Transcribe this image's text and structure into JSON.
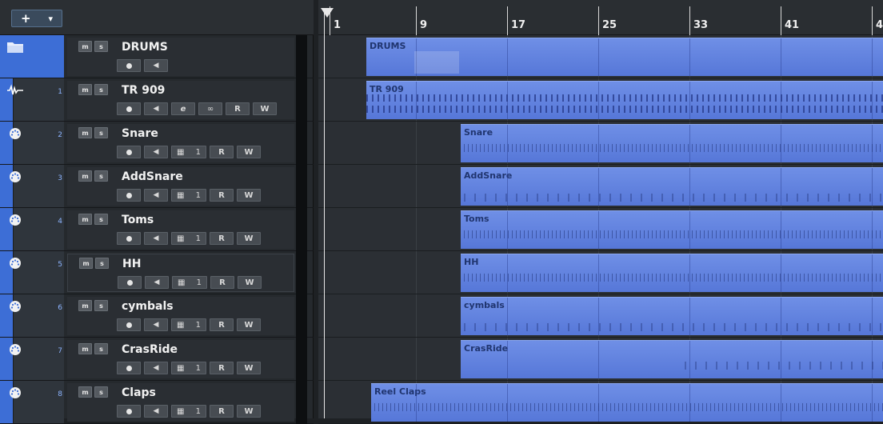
{
  "toolbar": {
    "add_label": "+",
    "dropdown": "▾"
  },
  "buttons": {
    "mute": "m",
    "solo": "s",
    "read": "R",
    "write": "W"
  },
  "tracks": [
    {
      "num": "",
      "name": "DRUMS",
      "type": "folder"
    },
    {
      "num": "1",
      "name": "TR 909",
      "type": "audio"
    },
    {
      "num": "2",
      "name": "Snare",
      "type": "midi",
      "channel": "1"
    },
    {
      "num": "3",
      "name": "AddSnare",
      "type": "midi",
      "channel": "1"
    },
    {
      "num": "4",
      "name": "Toms",
      "type": "midi",
      "channel": "1"
    },
    {
      "num": "5",
      "name": "HH",
      "type": "midi",
      "channel": "1"
    },
    {
      "num": "6",
      "name": "cymbals",
      "type": "midi",
      "channel": "1"
    },
    {
      "num": "7",
      "name": "CrasRide",
      "type": "midi",
      "channel": "1"
    },
    {
      "num": "8",
      "name": "Claps",
      "type": "midi",
      "channel": "1"
    }
  ],
  "ruler": {
    "bars": [
      "1",
      "9",
      "17",
      "25",
      "33",
      "41",
      "4"
    ]
  },
  "events": [
    {
      "name": "DRUMS"
    },
    {
      "name": "TR 909"
    },
    {
      "name": "Snare"
    },
    {
      "name": "AddSnare"
    },
    {
      "name": "Toms"
    },
    {
      "name": "HH"
    },
    {
      "name": "cymbals"
    },
    {
      "name": "CrasRide"
    },
    {
      "name": "Reel Claps"
    }
  ],
  "colors": {
    "accent": "#3d6ed6",
    "event": "#6f8fe6",
    "background": "#2b2f34"
  },
  "icons": {
    "folder": "folder-icon",
    "audio": "waveform-icon",
    "midi": "instrument-icon"
  }
}
